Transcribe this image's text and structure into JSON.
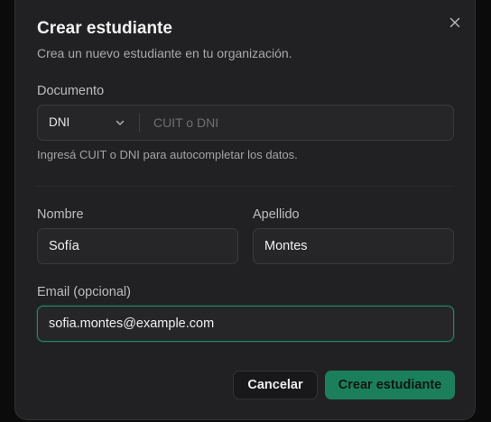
{
  "dialog": {
    "title": "Crear estudiante",
    "subtitle": "Crea un nuevo estudiante en tu organización.",
    "close_icon": "close-icon"
  },
  "document": {
    "label": "Documento",
    "type_selected": "DNI",
    "placeholder": "CUIT o DNI",
    "value": "",
    "hint": "Ingresá CUIT o DNI para autocompletar los datos."
  },
  "first_name": {
    "label": "Nombre",
    "value": "Sofía"
  },
  "last_name": {
    "label": "Apellido",
    "value": "Montes"
  },
  "email": {
    "label": "Email (opcional)",
    "value": "sofia.montes@example.com"
  },
  "actions": {
    "cancel_label": "Cancelar",
    "submit_label": "Crear estudiante"
  },
  "colors": {
    "accent": "#1c7f5c",
    "focus_ring": "#1f8a63",
    "background": "#212123"
  }
}
